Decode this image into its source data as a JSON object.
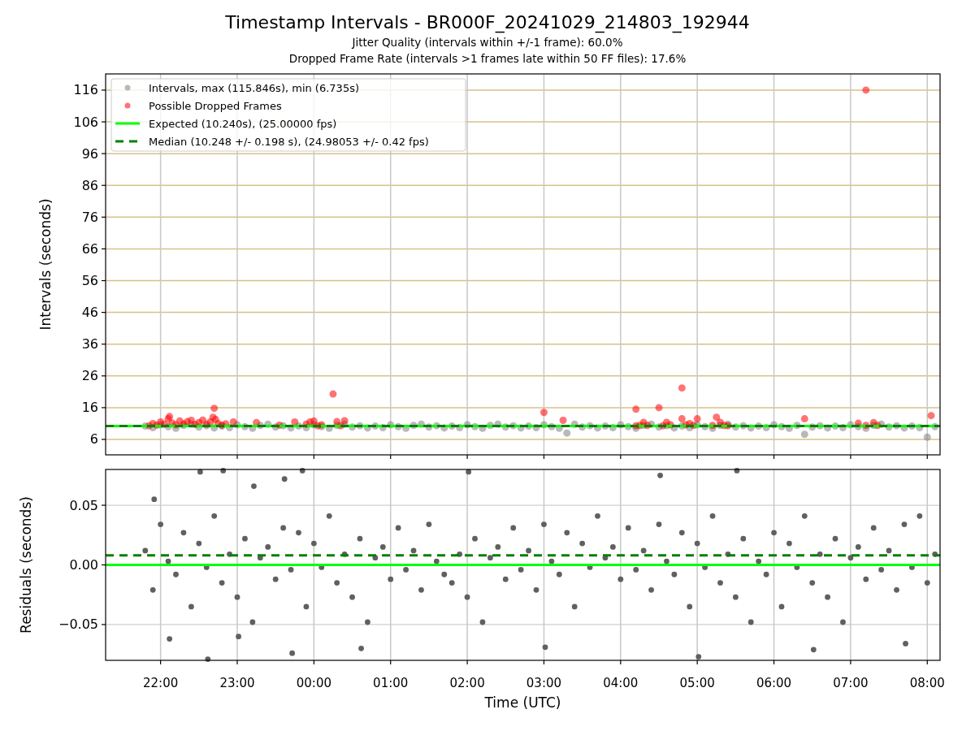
{
  "figure": {
    "title": "Timestamp Intervals - BR000F_20241029_214803_192944",
    "subtitles": [
      "Jitter Quality (intervals within +/-1 frame): 60.0%",
      "Dropped Frame Rate (intervals >1 frames late within 50 FF files): 17.6%"
    ]
  },
  "top_panel": {
    "chart_data": {
      "type": "scatter",
      "ylabel": "Intervals (seconds)",
      "grid": true,
      "legend": true,
      "xlim": [
        "2024-10-29T21:17",
        "2024-10-30T08:10"
      ],
      "ylim": [
        1.14,
        121.1
      ],
      "yticks": [
        6,
        16,
        26,
        36,
        46,
        56,
        66,
        76,
        86,
        96,
        106,
        116
      ],
      "series": [
        {
          "name": "Intervals, max (115.846s), min (6.735s)",
          "color": "#808080",
          "x": [
            "2024-10-29T21:48",
            "2024-10-29T21:54",
            "2024-10-29T22:00",
            "2024-10-29T22:06",
            "2024-10-29T22:12",
            "2024-10-29T22:18",
            "2024-10-29T22:24",
            "2024-10-29T22:30",
            "2024-10-29T22:36",
            "2024-10-29T22:42",
            "2024-10-29T22:48",
            "2024-10-29T22:54",
            "2024-10-29T23:00",
            "2024-10-29T23:06",
            "2024-10-29T23:12",
            "2024-10-29T23:18",
            "2024-10-29T23:24",
            "2024-10-29T23:30",
            "2024-10-29T23:36",
            "2024-10-29T23:42",
            "2024-10-29T23:48",
            "2024-10-29T23:54",
            "2024-10-30T00:00",
            "2024-10-30T00:06",
            "2024-10-30T00:12",
            "2024-10-30T00:18",
            "2024-10-30T00:24",
            "2024-10-30T00:30",
            "2024-10-30T00:36",
            "2024-10-30T00:42",
            "2024-10-30T00:48",
            "2024-10-30T00:54",
            "2024-10-30T01:00",
            "2024-10-30T01:06",
            "2024-10-30T01:12",
            "2024-10-30T01:18",
            "2024-10-30T01:24",
            "2024-10-30T01:30",
            "2024-10-30T01:36",
            "2024-10-30T01:42",
            "2024-10-30T01:48",
            "2024-10-30T01:54",
            "2024-10-30T02:00",
            "2024-10-30T02:06",
            "2024-10-30T02:12",
            "2024-10-30T02:18",
            "2024-10-30T02:24",
            "2024-10-30T02:30",
            "2024-10-30T02:36",
            "2024-10-30T02:42",
            "2024-10-30T02:48",
            "2024-10-30T02:54",
            "2024-10-30T03:00",
            "2024-10-30T03:06",
            "2024-10-30T03:12",
            "2024-10-30T03:18",
            "2024-10-30T03:24",
            "2024-10-30T03:30",
            "2024-10-30T03:36",
            "2024-10-30T03:42",
            "2024-10-30T03:48",
            "2024-10-30T03:54",
            "2024-10-30T04:00",
            "2024-10-30T04:06",
            "2024-10-30T04:12",
            "2024-10-30T04:18",
            "2024-10-30T04:24",
            "2024-10-30T04:30",
            "2024-10-30T04:36",
            "2024-10-30T04:42",
            "2024-10-30T04:48",
            "2024-10-30T04:54",
            "2024-10-30T05:00",
            "2024-10-30T05:06",
            "2024-10-30T05:12",
            "2024-10-30T05:18",
            "2024-10-30T05:24",
            "2024-10-30T05:30",
            "2024-10-30T05:36",
            "2024-10-30T05:42",
            "2024-10-30T05:48",
            "2024-10-30T05:54",
            "2024-10-30T06:00",
            "2024-10-30T06:06",
            "2024-10-30T06:12",
            "2024-10-30T06:18",
            "2024-10-30T06:24",
            "2024-10-30T06:30",
            "2024-10-30T06:36",
            "2024-10-30T06:42",
            "2024-10-30T06:48",
            "2024-10-30T06:54",
            "2024-10-30T07:00",
            "2024-10-30T07:06",
            "2024-10-30T07:12",
            "2024-10-30T07:18",
            "2024-10-30T07:24",
            "2024-10-30T07:30",
            "2024-10-30T07:36",
            "2024-10-30T07:42",
            "2024-10-30T07:48",
            "2024-10-30T07:54",
            "2024-10-30T08:00",
            "2024-10-30T08:06"
          ],
          "values": [
            10.2,
            9.7,
            10.6,
            10.0,
            9.5,
            10.4,
            10.8,
            9.9,
            10.3,
            9.6,
            10.2,
            9.7,
            10.6,
            10.0,
            9.5,
            10.4,
            10.8,
            9.9,
            10.3,
            9.6,
            10.2,
            9.7,
            10.6,
            10.0,
            9.5,
            10.4,
            10.8,
            9.9,
            10.3,
            9.6,
            10.2,
            9.7,
            10.6,
            10.0,
            9.5,
            10.4,
            10.8,
            9.9,
            10.3,
            9.6,
            10.2,
            9.7,
            10.6,
            10.0,
            9.5,
            10.4,
            10.8,
            9.9,
            10.3,
            9.6,
            10.2,
            9.7,
            10.6,
            10.0,
            9.5,
            8.0,
            10.8,
            9.9,
            10.3,
            9.6,
            10.2,
            9.7,
            10.6,
            10.0,
            9.5,
            10.4,
            10.8,
            9.9,
            10.3,
            9.6,
            10.2,
            9.7,
            10.6,
            10.0,
            9.5,
            10.4,
            10.8,
            9.9,
            10.3,
            9.6,
            10.2,
            9.7,
            10.6,
            10.0,
            9.5,
            10.4,
            7.6,
            9.9,
            10.3,
            9.6,
            10.2,
            9.7,
            10.6,
            10.0,
            9.5,
            10.4,
            10.8,
            9.9,
            10.3,
            9.6,
            10.2,
            9.7,
            6.7,
            10.0
          ]
        },
        {
          "name": "Possible Dropped Frames",
          "color": "#ff0000",
          "x": [
            "2024-10-29T21:51",
            "2024-10-29T21:54",
            "2024-10-29T21:57",
            "2024-10-29T22:00",
            "2024-10-29T22:03",
            "2024-10-29T22:06",
            "2024-10-29T22:07",
            "2024-10-29T22:09",
            "2024-10-29T22:12",
            "2024-10-29T22:15",
            "2024-10-29T22:18",
            "2024-10-29T22:21",
            "2024-10-29T22:24",
            "2024-10-29T22:27",
            "2024-10-29T22:30",
            "2024-10-29T22:33",
            "2024-10-29T22:36",
            "2024-10-29T22:39",
            "2024-10-29T22:41",
            "2024-10-29T22:42",
            "2024-10-29T22:43",
            "2024-10-29T22:45",
            "2024-10-29T22:48",
            "2024-10-29T22:51",
            "2024-10-29T22:57",
            "2024-10-29T23:15",
            "2024-10-29T23:33",
            "2024-10-29T23:45",
            "2024-10-29T23:54",
            "2024-10-29T23:57",
            "2024-10-30T00:00",
            "2024-10-30T00:03",
            "2024-10-30T00:06",
            "2024-10-30T00:15",
            "2024-10-30T00:18",
            "2024-10-30T00:21",
            "2024-10-30T00:24",
            "2024-10-30T03:00",
            "2024-10-30T03:15",
            "2024-10-30T04:12",
            "2024-10-30T04:12",
            "2024-10-30T04:15",
            "2024-10-30T04:18",
            "2024-10-30T04:21",
            "2024-10-30T04:30",
            "2024-10-30T04:33",
            "2024-10-30T04:36",
            "2024-10-30T04:39",
            "2024-10-30T04:48",
            "2024-10-30T04:48",
            "2024-10-30T04:51",
            "2024-10-30T04:54",
            "2024-10-30T04:57",
            "2024-10-30T05:00",
            "2024-10-30T05:12",
            "2024-10-30T05:15",
            "2024-10-30T05:18",
            "2024-10-30T05:21",
            "2024-10-30T05:24",
            "2024-10-30T06:24",
            "2024-10-30T07:06",
            "2024-10-30T07:12",
            "2024-10-30T07:12",
            "2024-10-30T07:18",
            "2024-10-30T07:21",
            "2024-10-30T08:03"
          ],
          "values": [
            10.3,
            11,
            10.5,
            11.5,
            10.8,
            12.5,
            13.2,
            11.2,
            10.6,
            11.8,
            10.9,
            11.6,
            12,
            10.7,
            11.3,
            12.1,
            10.8,
            11.5,
            13,
            15.8,
            12.3,
            11,
            10.5,
            10.9,
            11.5,
            11.3,
            10.5,
            11.5,
            10.8,
            11.5,
            11.8,
            10.3,
            10.6,
            20.3,
            11.6,
            10.3,
            11.9,
            14.5,
            12,
            15.5,
            10.3,
            10.4,
            11.4,
            10.4,
            16,
            10.3,
            11.4,
            10.6,
            22.2,
            12.5,
            10.6,
            11,
            10.4,
            12.5,
            10.4,
            13,
            11.4,
            10.4,
            10.3,
            12.5,
            11.1,
            116,
            10.4,
            11.3,
            10.4,
            13.5
          ]
        },
        {
          "name": "Expected (10.240s), (25.00000 fps)",
          "type": "line",
          "color": "#00ff00",
          "x": [
            "2024-10-29T21:17",
            "2024-10-30T08:10"
          ],
          "values": [
            10.24,
            10.24
          ]
        },
        {
          "name": "Median (10.248 +/- 0.198 s), (24.98053 +/- 0.42 fps)",
          "type": "line",
          "line_style": "dashed",
          "color": "#008000",
          "x": [
            "2024-10-29T21:17",
            "2024-10-30T08:10"
          ],
          "values": [
            10.248,
            10.248
          ]
        }
      ]
    }
  },
  "bottom_panel": {
    "chart_data": {
      "type": "scatter",
      "xlabel": "Time (UTC)",
      "ylabel": "Residuals (seconds)",
      "grid": true,
      "xlim": [
        "2024-10-29T21:17",
        "2024-10-30T08:10"
      ],
      "ylim": [
        -0.08,
        0.08
      ],
      "xticks": [
        {
          "value": "2024-10-29T22:00",
          "label": "22:00"
        },
        {
          "value": "2024-10-29T23:00",
          "label": "23:00"
        },
        {
          "value": "2024-10-30T00:00",
          "label": "00:00"
        },
        {
          "value": "2024-10-30T01:00",
          "label": "01:00"
        },
        {
          "value": "2024-10-30T02:00",
          "label": "02:00"
        },
        {
          "value": "2024-10-30T03:00",
          "label": "03:00"
        },
        {
          "value": "2024-10-30T04:00",
          "label": "04:00"
        },
        {
          "value": "2024-10-30T05:00",
          "label": "05:00"
        },
        {
          "value": "2024-10-30T06:00",
          "label": "06:00"
        },
        {
          "value": "2024-10-30T07:00",
          "label": "07:00"
        },
        {
          "value": "2024-10-30T08:00",
          "label": "08:00"
        }
      ],
      "yticks": [
        {
          "value": -0.05,
          "label": "−0.05"
        },
        {
          "value": 0,
          "label": "0.00"
        },
        {
          "value": 0.05,
          "label": "0.05"
        }
      ],
      "series": [
        {
          "color": "#606060",
          "x": [
            "2024-10-29T21:48",
            "2024-10-29T21:54",
            "2024-10-29T22:00",
            "2024-10-29T22:06",
            "2024-10-29T22:12",
            "2024-10-29T22:18",
            "2024-10-29T22:24",
            "2024-10-29T22:30",
            "2024-10-29T22:36",
            "2024-10-29T22:42",
            "2024-10-29T22:48",
            "2024-10-29T22:54",
            "2024-10-29T23:00",
            "2024-10-29T23:06",
            "2024-10-29T23:12",
            "2024-10-29T23:18",
            "2024-10-29T23:24",
            "2024-10-29T23:30",
            "2024-10-29T23:36",
            "2024-10-29T23:42",
            "2024-10-29T23:48",
            "2024-10-29T23:54",
            "2024-10-30T00:00",
            "2024-10-30T00:06",
            "2024-10-30T00:12",
            "2024-10-30T00:18",
            "2024-10-30T00:24",
            "2024-10-30T00:30",
            "2024-10-30T00:36",
            "2024-10-30T00:42",
            "2024-10-30T00:48",
            "2024-10-30T00:54",
            "2024-10-30T01:00",
            "2024-10-30T01:06",
            "2024-10-30T01:12",
            "2024-10-30T01:18",
            "2024-10-30T01:24",
            "2024-10-30T01:30",
            "2024-10-30T01:36",
            "2024-10-30T01:42",
            "2024-10-30T01:48",
            "2024-10-30T01:54",
            "2024-10-30T02:00",
            "2024-10-30T02:06",
            "2024-10-30T02:12",
            "2024-10-30T02:18",
            "2024-10-30T02:24",
            "2024-10-30T02:30",
            "2024-10-30T02:36",
            "2024-10-30T02:42",
            "2024-10-30T02:48",
            "2024-10-30T02:54",
            "2024-10-30T03:00",
            "2024-10-30T03:06",
            "2024-10-30T03:12",
            "2024-10-30T03:18",
            "2024-10-30T03:24",
            "2024-10-30T03:30",
            "2024-10-30T03:36",
            "2024-10-30T03:42",
            "2024-10-30T03:48",
            "2024-10-30T03:54",
            "2024-10-30T04:00",
            "2024-10-30T04:06",
            "2024-10-30T04:12",
            "2024-10-30T04:18",
            "2024-10-30T04:24",
            "2024-10-30T04:30",
            "2024-10-30T04:36",
            "2024-10-30T04:42",
            "2024-10-30T04:48",
            "2024-10-30T04:54",
            "2024-10-30T05:00",
            "2024-10-30T05:06",
            "2024-10-30T05:12",
            "2024-10-30T05:18",
            "2024-10-30T05:24",
            "2024-10-30T05:30",
            "2024-10-30T05:36",
            "2024-10-30T05:42",
            "2024-10-30T05:48",
            "2024-10-30T05:54",
            "2024-10-30T06:00",
            "2024-10-30T06:06",
            "2024-10-30T06:12",
            "2024-10-30T06:18",
            "2024-10-30T06:24",
            "2024-10-30T06:30",
            "2024-10-30T06:36",
            "2024-10-30T06:42",
            "2024-10-30T06:48",
            "2024-10-30T06:54",
            "2024-10-30T07:00",
            "2024-10-30T07:06",
            "2024-10-30T07:12",
            "2024-10-30T07:18",
            "2024-10-30T07:24",
            "2024-10-30T07:30",
            "2024-10-30T07:36",
            "2024-10-30T07:42",
            "2024-10-30T07:48",
            "2024-10-30T07:54",
            "2024-10-30T08:00",
            "2024-10-30T08:06"
          ],
          "values": [
            0.012,
            -0.021,
            0.034,
            0.003,
            -0.008,
            0.027,
            -0.035,
            0.018,
            -0.002,
            0.041,
            -0.015,
            0.009,
            -0.027,
            0.022,
            -0.048,
            0.006,
            0.015,
            -0.012,
            0.031,
            -0.004,
            0.027,
            -0.035,
            0.018,
            -0.002,
            0.041,
            -0.015,
            0.009,
            -0.027,
            0.022,
            -0.048,
            0.006,
            0.015,
            -0.012,
            0.031,
            -0.004,
            0.012,
            -0.021,
            0.034,
            0.003,
            -0.008,
            -0.015,
            0.009,
            -0.027,
            0.022,
            -0.048,
            0.006,
            0.015,
            -0.012,
            0.031,
            -0.004,
            0.012,
            -0.021,
            0.034,
            0.003,
            -0.008,
            0.027,
            -0.035,
            0.018,
            -0.002,
            0.041,
            0.006,
            0.015,
            -0.012,
            0.031,
            -0.004,
            0.012,
            -0.021,
            0.034,
            0.003,
            -0.008,
            0.027,
            -0.035,
            0.018,
            -0.002,
            0.041,
            -0.015,
            0.009,
            -0.027,
            0.022,
            -0.048,
            0.003,
            -0.008,
            0.027,
            -0.035,
            0.018,
            -0.002,
            0.041,
            -0.015,
            0.009,
            -0.027,
            0.022,
            -0.048,
            0.006,
            0.015,
            -0.012,
            0.031,
            -0.004,
            0.012,
            -0.021,
            0.034,
            -0.002,
            0.041,
            -0.015,
            0.009
          ]
        },
        {
          "color": "#606060",
          "x": [
            "2024-10-29T21:55",
            "2024-10-29T22:07",
            "2024-10-29T22:31",
            "2024-10-29T22:37",
            "2024-10-29T22:49",
            "2024-10-29T23:01",
            "2024-10-29T23:13",
            "2024-10-29T23:37",
            "2024-10-29T23:43",
            "2024-10-29T23:51",
            "2024-10-30T00:37",
            "2024-10-30T02:01",
            "2024-10-30T03:01",
            "2024-10-30T04:31",
            "2024-10-30T05:01",
            "2024-10-30T05:31",
            "2024-10-30T06:31",
            "2024-10-30T07:43"
          ],
          "values": [
            0.055,
            -0.062,
            0.078,
            -0.079,
            0.079,
            -0.06,
            0.066,
            0.072,
            -0.074,
            0.079,
            -0.07,
            0.078,
            -0.069,
            0.075,
            -0.077,
            0.079,
            -0.071,
            -0.066
          ]
        },
        {
          "type": "line",
          "color": "#00ff00",
          "x": [
            "2024-10-29T21:17",
            "2024-10-30T08:10"
          ],
          "values": [
            0,
            0
          ]
        },
        {
          "type": "line",
          "line_style": "dashed",
          "color": "#008000",
          "x": [
            "2024-10-29T21:17",
            "2024-10-30T08:10"
          ],
          "values": [
            0.008,
            0.008
          ]
        }
      ]
    }
  }
}
